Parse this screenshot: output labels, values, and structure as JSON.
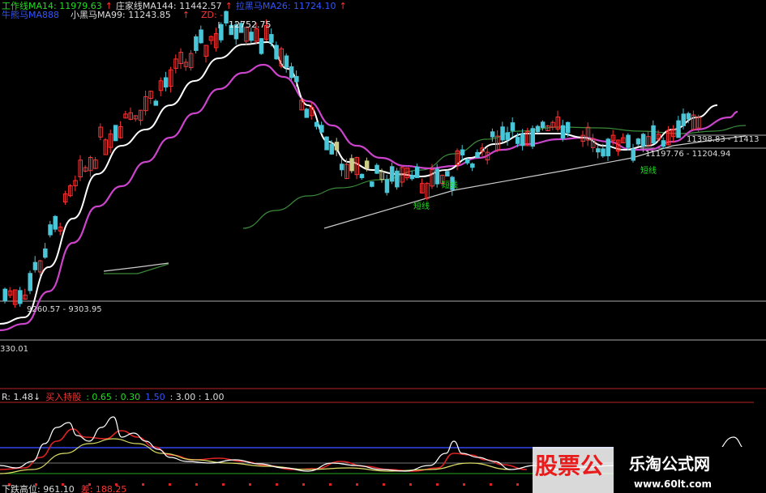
{
  "header": {
    "line1": [
      {
        "text": "工作线MA14: 11979.63",
        "color": "#22dd22"
      },
      {
        "text": "↑",
        "color": "#ff3333"
      },
      {
        "text": "庄家线MA144: 11442.57",
        "color": "#dddddd"
      },
      {
        "text": "↑",
        "color": "#ff3333"
      },
      {
        "text": "拉黑马MA26: 11724.10",
        "color": "#3355ff"
      },
      {
        "text": "↑",
        "color": "#ff3333"
      }
    ],
    "line2": [
      {
        "text": "牛熊马MA888",
        "color": "#3355ff"
      },
      {
        "text": "小黑马MA99: 11243.85",
        "color": "#dddddd"
      },
      {
        "text": "↑",
        "color": "#ff3333"
      },
      {
        "text": "ZD: -",
        "color": "#ff3333"
      }
    ]
  },
  "annotations": {
    "high": "12752.75",
    "range_right1": "11398.83 - 11413",
    "range_right2": "11197.76 - 11204.94",
    "range_left": "9260.57 - 9303.95",
    "low": "330.01",
    "short1": "短线",
    "short2": "短线",
    "short3": "短线"
  },
  "indicator_header": [
    {
      "text": "R: 1.48↓",
      "color": "#dddddd"
    },
    {
      "text": "买入持股",
      "color": "#ff3333"
    },
    {
      "text": ": 0.65 : 0.30",
      "color": "#22dd22"
    },
    {
      "text": "1.50",
      "color": "#3355ff"
    },
    {
      "text": ": 3.00 : 1.00",
      "color": "#dddddd"
    }
  ],
  "indicator_bottom": [
    {
      "text": "下跌高位: 961.10",
      "color": "#dddddd"
    },
    {
      "text": "差: 188.25",
      "color": "#ff3333"
    }
  ],
  "watermark": {
    "left": "股票公",
    "right": "乐淘公式网",
    "url": "www.60lt.com"
  },
  "colors": {
    "up": "#ff3333",
    "down": "#49c6d8",
    "doji": "#cccc88",
    "purple": "#cc44cc",
    "white_ma": "#ffffff",
    "green_ma": "#3a8a3a"
  },
  "chart_data": {
    "type": "candlestick",
    "y_range": [
      9000,
      13000
    ],
    "price_labels": {
      "max": 12752.75
    },
    "series": [
      {
        "name": "工作线MA14",
        "approx_values": [
          9220,
          9260,
          9500,
          10000,
          10500,
          10900,
          11200,
          11400,
          11600,
          11800,
          12050,
          12300,
          12480,
          12600,
          12300,
          11900,
          11500,
          11200,
          11050,
          10980,
          11000,
          11050,
          11150,
          11300,
          11400,
          11450,
          11420,
          11380,
          11300,
          11350,
          11500,
          11700
        ]
      },
      {
        "name": "拉黑马MA26",
        "approx_values": [
          9200,
          9230,
          9350,
          9650,
          10050,
          10400,
          10750,
          11050,
          11300,
          11550,
          11750,
          11950,
          12150,
          12300,
          12200,
          11950,
          11650,
          11350,
          11150,
          11020,
          11000,
          11010,
          11050,
          11130,
          11200,
          11240,
          11250,
          11260,
          11220,
          11240,
          11350,
          11550
        ]
      }
    ]
  }
}
